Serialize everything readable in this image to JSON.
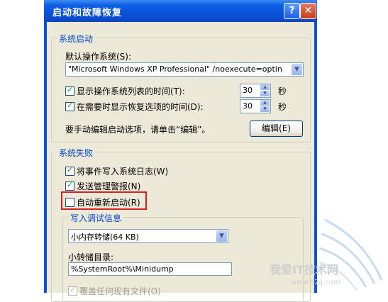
{
  "window": {
    "title": "启动和故障恢复",
    "help_glyph": "?",
    "close_glyph": "✕"
  },
  "system_startup": {
    "group_label": "系统启动",
    "default_os_label": "默认操作系统(S):",
    "default_os_value": "\"Microsoft Windows XP Professional\" /noexecute=optin",
    "show_os_list": {
      "label": "显示操作系统列表的时间(T):",
      "checked": true,
      "value": "30",
      "unit": "秒"
    },
    "show_recovery": {
      "label": "在需要时显示恢复选项的时间(D):",
      "checked": true,
      "value": "30",
      "unit": "秒"
    },
    "edit_hint": "要手动编辑启动选项，请单击“编辑”。",
    "edit_button": "编辑(E)"
  },
  "system_failure": {
    "group_label": "系统失败",
    "write_event": {
      "label": "将事件写入系统日志(W)",
      "checked": true
    },
    "send_alert": {
      "label": "发送管理警报(N)",
      "checked": true
    },
    "auto_restart": {
      "label": "自动重新启动(R)",
      "checked": false
    },
    "debug_info": {
      "group_label": "写入调试信息",
      "dump_type": "小内存转储(64 KB)",
      "dump_dir_label": "小转储目录:",
      "dump_dir_value": "%SystemRoot%\\Minidump",
      "overwrite": {
        "label": "覆盖任何现有文件(O)",
        "checked": true
      }
    }
  },
  "watermark": {
    "text": "我爱IT技术网",
    "url": "www.52ij.com"
  },
  "colors": {
    "title_bar": "#0a51d8",
    "dialog_bg": "#ece9d8",
    "group_label": "#0046d5",
    "highlight": "#d92020"
  }
}
